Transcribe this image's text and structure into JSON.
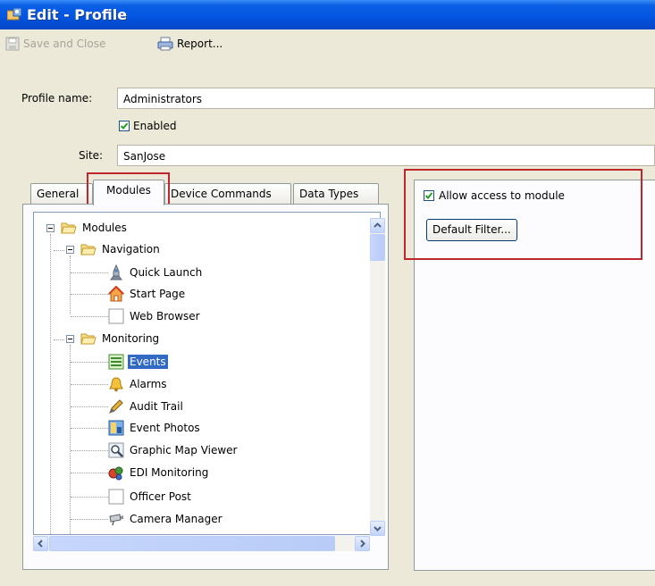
{
  "window": {
    "title": "Edit - Profile"
  },
  "toolbar": {
    "save_close_label": "Save and Close",
    "report_label": "Report..."
  },
  "form": {
    "profile_name_label": "Profile name:",
    "profile_name_value": "Administrators",
    "enabled_label": "Enabled",
    "enabled_checked": true,
    "site_label": "Site:",
    "site_value": "SanJose"
  },
  "tabs": [
    {
      "label": "General"
    },
    {
      "label": "Modules",
      "active": true
    },
    {
      "label": "Device Commands"
    },
    {
      "label": "Data Types"
    }
  ],
  "tree": {
    "root": {
      "label": "Modules",
      "icon": "folder-open-icon"
    },
    "navigation": {
      "label": "Navigation",
      "items": [
        {
          "label": "Quick Launch",
          "icon": "rocket-icon"
        },
        {
          "label": "Start Page",
          "icon": "home-icon"
        },
        {
          "label": "Web Browser",
          "icon": "blank-page-icon"
        }
      ]
    },
    "monitoring": {
      "label": "Monitoring",
      "items": [
        {
          "label": "Events",
          "icon": "events-list-icon",
          "selected": true
        },
        {
          "label": "Alarms",
          "icon": "bell-icon"
        },
        {
          "label": "Audit Trail",
          "icon": "audit-pen-icon"
        },
        {
          "label": "Event Photos",
          "icon": "photo-icon"
        },
        {
          "label": "Graphic Map Viewer",
          "icon": "magnifier-icon"
        },
        {
          "label": "EDI Monitoring",
          "icon": "edi-icon"
        },
        {
          "label": "Officer Post",
          "icon": "blank-page-icon"
        },
        {
          "label": "Camera Manager",
          "icon": "camera-icon"
        }
      ]
    }
  },
  "right_panel": {
    "allow_access_label": "Allow access to module",
    "allow_access_checked": true,
    "default_filter_label": "Default Filter..."
  },
  "colors": {
    "highlight_box": "#c0272d",
    "selection": "#316ac5",
    "titlebar": "#0a5fe4"
  }
}
